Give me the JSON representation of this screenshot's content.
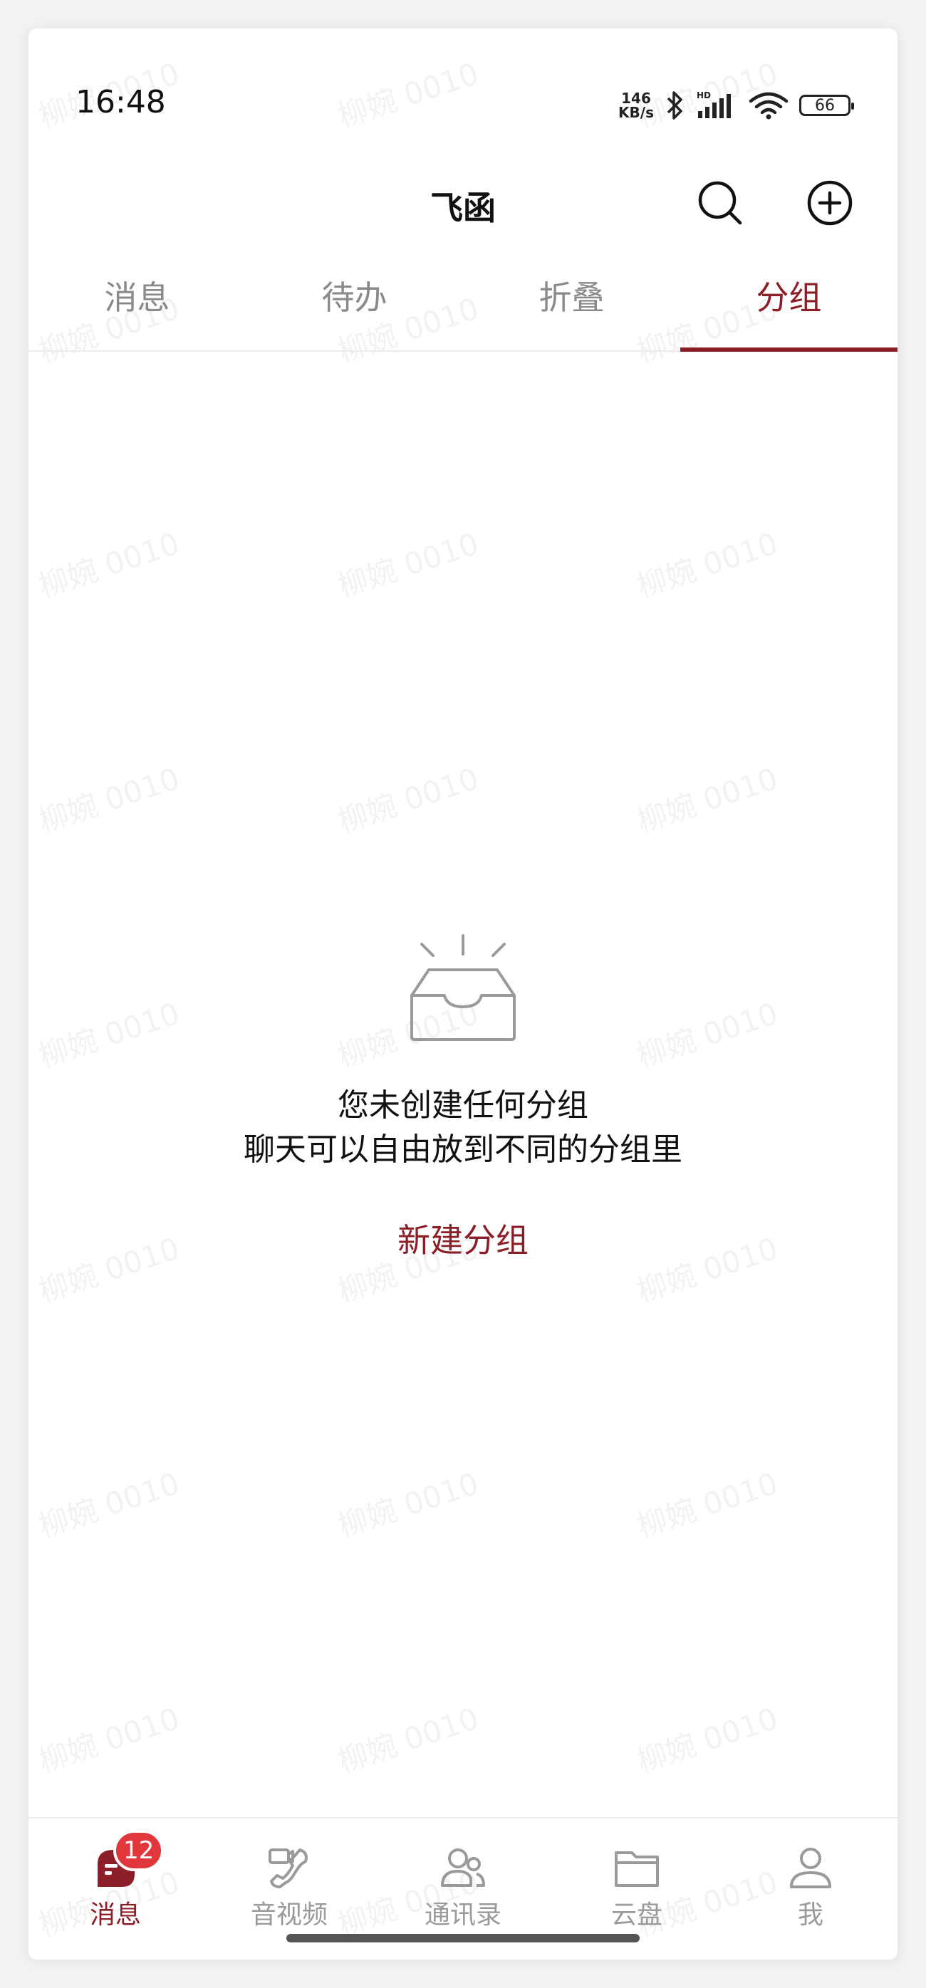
{
  "status_bar": {
    "time": "16:48",
    "net_speed_value": "146",
    "net_speed_unit": "KB/s",
    "battery": "66"
  },
  "header": {
    "title": "飞函"
  },
  "tabs": [
    {
      "label": "消息"
    },
    {
      "label": "待办"
    },
    {
      "label": "折叠"
    },
    {
      "label": "分组"
    }
  ],
  "empty_state": {
    "title": "您未创建任何分组",
    "subtitle": "聊天可以自由放到不同的分组里",
    "action": "新建分组"
  },
  "bottom_nav": [
    {
      "label": "消息",
      "icon": "message-icon",
      "badge": "12"
    },
    {
      "label": "音视频",
      "icon": "phone-video-icon"
    },
    {
      "label": "通讯录",
      "icon": "contacts-icon"
    },
    {
      "label": "云盘",
      "icon": "folder-icon"
    },
    {
      "label": "我",
      "icon": "person-icon"
    }
  ],
  "watermark": "柳婉 0010",
  "colors": {
    "accent": "#8b1e26",
    "badge": "#e0363c",
    "inactive": "#8a8a8a"
  }
}
